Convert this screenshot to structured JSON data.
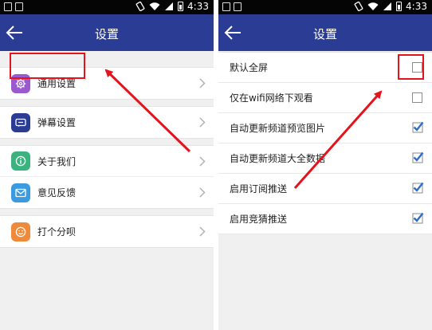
{
  "status_bar": {
    "time": "4:33"
  },
  "left_screen": {
    "title": "设置",
    "groups": [
      [
        {
          "label": "通用设置",
          "icon": "gear-icon",
          "color": "#9b59d0"
        }
      ],
      [
        {
          "label": "弹幕设置",
          "icon": "danmaku-icon",
          "color": "#2a3c94"
        }
      ],
      [
        {
          "label": "关于我们",
          "icon": "info-icon",
          "color": "#3bb37f"
        },
        {
          "label": "意见反馈",
          "icon": "mail-icon",
          "color": "#3c9ae0"
        }
      ],
      [
        {
          "label": "打个分呗",
          "icon": "smiley-icon",
          "color": "#f08a3b"
        }
      ]
    ]
  },
  "right_screen": {
    "title": "设置",
    "options": [
      {
        "label": "默认全屏",
        "checked": false
      },
      {
        "label": "仅在wifi网络下观看",
        "checked": false
      },
      {
        "label": "自动更新频道预览图片",
        "checked": true
      },
      {
        "label": "自动更新频道大全数据",
        "checked": true
      },
      {
        "label": "启用订阅推送",
        "checked": true
      },
      {
        "label": "启用竞猜推送",
        "checked": true
      }
    ]
  },
  "colors": {
    "nav_bar": "#2a3c94",
    "highlight": "#e5131b",
    "checkbox_checked": "#2b6ecf"
  }
}
